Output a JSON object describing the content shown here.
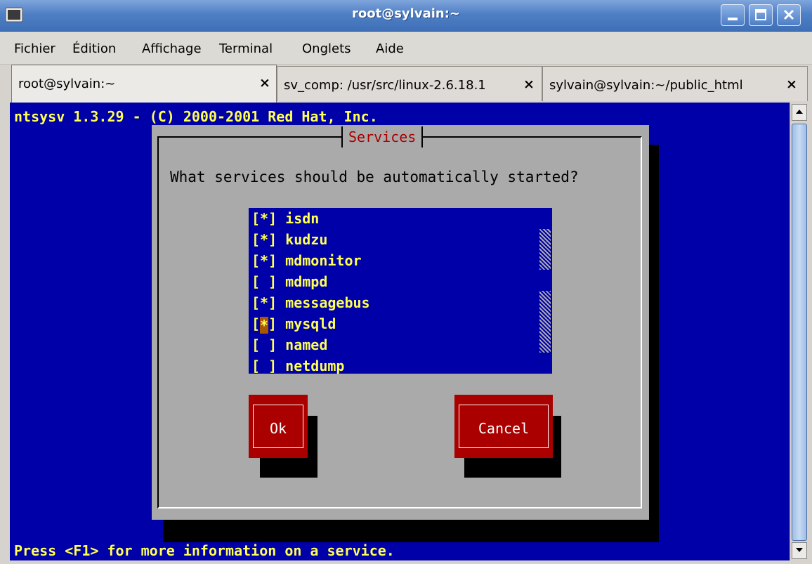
{
  "window": {
    "title": "root@sylvain:~",
    "minimize_glyph": "_",
    "maximize_glyph": "□",
    "close_glyph": "✕"
  },
  "menubar": {
    "items": [
      {
        "label": "Fichier"
      },
      {
        "label": "Édition"
      },
      {
        "label": "Affichage"
      },
      {
        "label": "Terminal"
      },
      {
        "label": "Onglets"
      },
      {
        "label": "Aide"
      }
    ]
  },
  "tabs": [
    {
      "label": "root@sylvain:~",
      "close": "×",
      "active": true
    },
    {
      "label": "sv_comp: /usr/src/linux-2.6.18.1",
      "close": "×",
      "active": false
    },
    {
      "label": "sylvain@sylvain:~/public_html",
      "close": "×",
      "active": false
    }
  ],
  "terminal": {
    "header": "ntsysv 1.3.29 - (C) 2000-2001 Red Hat, Inc.",
    "footer": "Press <F1> for more information on a service.",
    "dialog": {
      "title": "Services",
      "prompt": "What services should be automatically started?",
      "services": [
        {
          "checkbox": "[*]",
          "name": "isdn",
          "enabled": true
        },
        {
          "checkbox": "[*]",
          "name": "kudzu",
          "enabled": true
        },
        {
          "checkbox": "[*]",
          "name": "mdmonitor",
          "enabled": true
        },
        {
          "checkbox": "[ ]",
          "name": "mdmpd",
          "enabled": false
        },
        {
          "checkbox": "[*]",
          "name": "messagebus",
          "enabled": true
        },
        {
          "checkbox_left": "[",
          "checkbox_mark": "*",
          "checkbox_right": "]",
          "name": "mysqld",
          "enabled": true,
          "focused": true
        },
        {
          "checkbox": "[ ]",
          "name": "named",
          "enabled": false
        },
        {
          "checkbox": "[ ]",
          "name": "netdump",
          "enabled": false
        }
      ],
      "ok_label": "Ok",
      "cancel_label": "Cancel"
    }
  },
  "colors": {
    "terminal_bg": "#0000a8",
    "terminal_fg": "#ffff54",
    "dialog_bg": "#aaaaaa",
    "button_bg": "#aa0000",
    "cursor": "#aa5500",
    "titlebar": "#4f7fc4"
  }
}
